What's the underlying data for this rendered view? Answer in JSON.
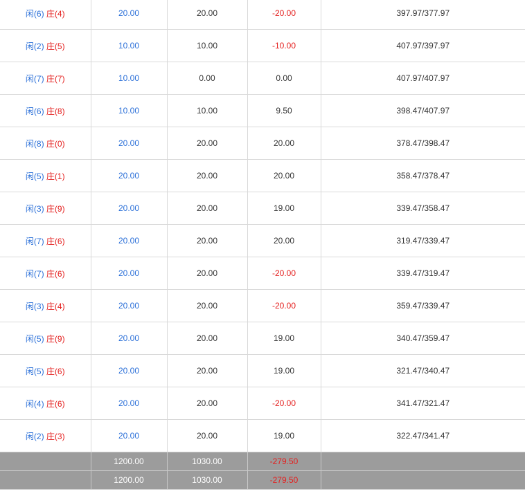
{
  "rows": [
    {
      "player": "闲(6)",
      "banker": "庄(4)",
      "bet": "20.00",
      "valid": "20.00",
      "result": "-20.00",
      "result_color": "red",
      "balance": "397.97/377.97"
    },
    {
      "player": "闲(2)",
      "banker": "庄(5)",
      "bet": "10.00",
      "valid": "10.00",
      "result": "-10.00",
      "result_color": "red",
      "balance": "407.97/397.97"
    },
    {
      "player": "闲(7)",
      "banker": "庄(7)",
      "bet": "10.00",
      "valid": "0.00",
      "result": "0.00",
      "result_color": "gray",
      "balance": "407.97/407.97"
    },
    {
      "player": "闲(6)",
      "banker": "庄(8)",
      "bet": "10.00",
      "valid": "10.00",
      "result": "9.50",
      "result_color": "gray",
      "balance": "398.47/407.97"
    },
    {
      "player": "闲(8)",
      "banker": "庄(0)",
      "bet": "20.00",
      "valid": "20.00",
      "result": "20.00",
      "result_color": "gray",
      "balance": "378.47/398.47"
    },
    {
      "player": "闲(5)",
      "banker": "庄(1)",
      "bet": "20.00",
      "valid": "20.00",
      "result": "20.00",
      "result_color": "gray",
      "balance": "358.47/378.47"
    },
    {
      "player": "闲(3)",
      "banker": "庄(9)",
      "bet": "20.00",
      "valid": "20.00",
      "result": "19.00",
      "result_color": "gray",
      "balance": "339.47/358.47"
    },
    {
      "player": "闲(7)",
      "banker": "庄(6)",
      "bet": "20.00",
      "valid": "20.00",
      "result": "20.00",
      "result_color": "gray",
      "balance": "319.47/339.47"
    },
    {
      "player": "闲(7)",
      "banker": "庄(6)",
      "bet": "20.00",
      "valid": "20.00",
      "result": "-20.00",
      "result_color": "red",
      "balance": "339.47/319.47"
    },
    {
      "player": "闲(3)",
      "banker": "庄(4)",
      "bet": "20.00",
      "valid": "20.00",
      "result": "-20.00",
      "result_color": "red",
      "balance": "359.47/339.47"
    },
    {
      "player": "闲(5)",
      "banker": "庄(9)",
      "bet": "20.00",
      "valid": "20.00",
      "result": "19.00",
      "result_color": "gray",
      "balance": "340.47/359.47"
    },
    {
      "player": "闲(5)",
      "banker": "庄(6)",
      "bet": "20.00",
      "valid": "20.00",
      "result": "19.00",
      "result_color": "gray",
      "balance": "321.47/340.47"
    },
    {
      "player": "闲(4)",
      "banker": "庄(6)",
      "bet": "20.00",
      "valid": "20.00",
      "result": "-20.00",
      "result_color": "red",
      "balance": "341.47/321.47"
    },
    {
      "player": "闲(2)",
      "banker": "庄(3)",
      "bet": "20.00",
      "valid": "20.00",
      "result": "19.00",
      "result_color": "gray",
      "balance": "322.47/341.47"
    }
  ],
  "totals": [
    {
      "label": "",
      "bet": "1200.00",
      "valid": "1030.00",
      "result": "-279.50",
      "balance": ""
    },
    {
      "label": "",
      "bet": "1200.00",
      "valid": "1030.00",
      "result": "-279.50",
      "balance": ""
    }
  ],
  "colors": {
    "player": "#2a6fd8",
    "banker": "#e4201f",
    "negative": "#e4201f",
    "total_bg": "#9c9c9c"
  }
}
